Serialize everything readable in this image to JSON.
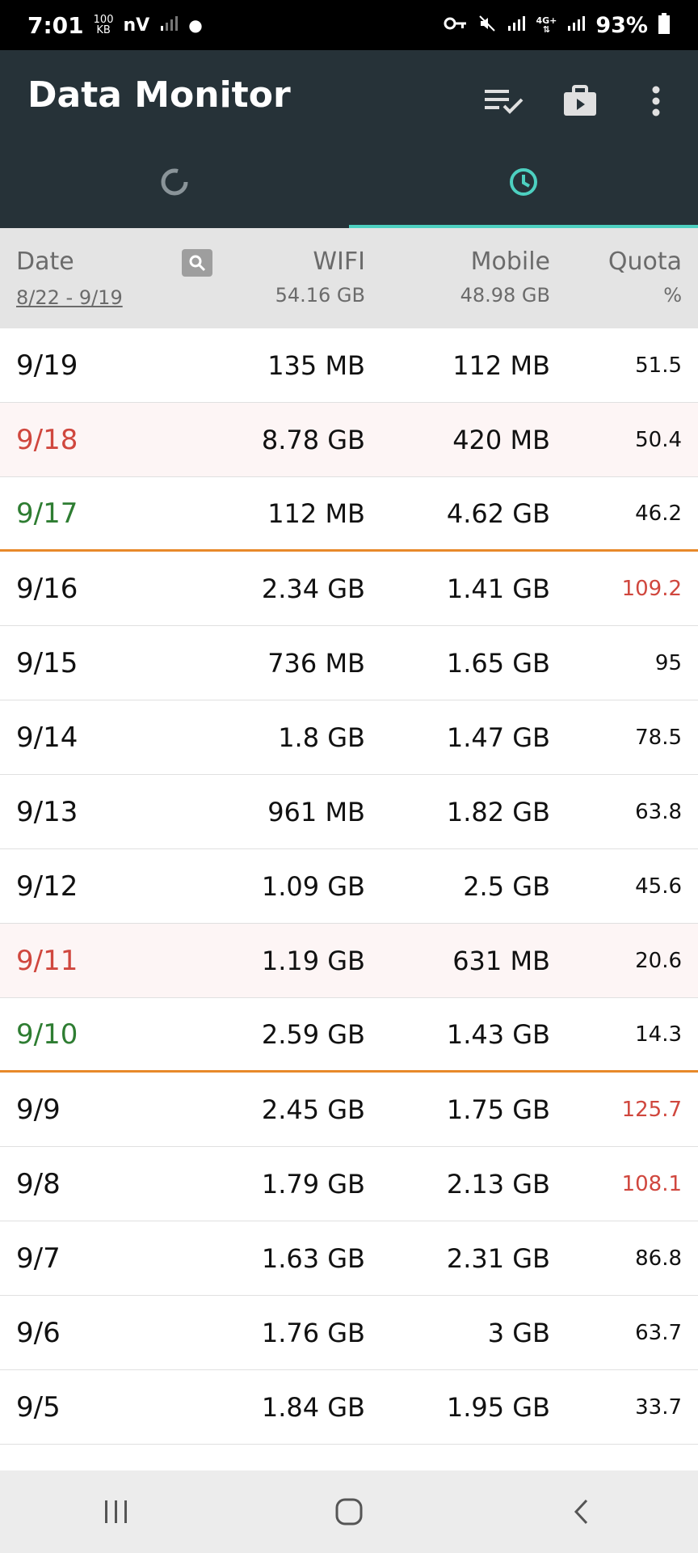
{
  "status_bar": {
    "time": "7:01",
    "speed_value": "100",
    "speed_unit": "KB",
    "carrier_text": "nV",
    "battery": "93%"
  },
  "app": {
    "title": "Data Monitor",
    "icons": [
      "checklist-icon",
      "briefcase-icon",
      "more-vert-icon"
    ],
    "tabs": [
      {
        "icon": "circle-progress-icon",
        "active": false
      },
      {
        "icon": "clock-icon",
        "active": true
      }
    ]
  },
  "header": {
    "date_label": "Date",
    "date_range": "8/22 - 9/19",
    "wifi_label": "WIFI",
    "wifi_total": "54.16 GB",
    "mobile_label": "Mobile",
    "mobile_total": "48.98 GB",
    "quota_label": "Quota",
    "quota_unit": "%"
  },
  "rows": [
    {
      "date": "9/19",
      "wifi": "135 MB",
      "mobile": "112 MB",
      "quota": "51.5"
    },
    {
      "date": "9/18",
      "wifi": "8.78 GB",
      "mobile": "420 MB",
      "quota": "50.4"
    },
    {
      "date": "9/17",
      "wifi": "112 MB",
      "mobile": "4.62 GB",
      "quota": "46.2"
    },
    {
      "date": "9/16",
      "wifi": "2.34 GB",
      "mobile": "1.41 GB",
      "quota": "109.2"
    },
    {
      "date": "9/15",
      "wifi": "736 MB",
      "mobile": "1.65 GB",
      "quota": "95"
    },
    {
      "date": "9/14",
      "wifi": "1.8 GB",
      "mobile": "1.47 GB",
      "quota": "78.5"
    },
    {
      "date": "9/13",
      "wifi": "961 MB",
      "mobile": "1.82 GB",
      "quota": "63.8"
    },
    {
      "date": "9/12",
      "wifi": "1.09 GB",
      "mobile": "2.5 GB",
      "quota": "45.6"
    },
    {
      "date": "9/11",
      "wifi": "1.19 GB",
      "mobile": "631 MB",
      "quota": "20.6"
    },
    {
      "date": "9/10",
      "wifi": "2.59 GB",
      "mobile": "1.43 GB",
      "quota": "14.3"
    },
    {
      "date": "9/9",
      "wifi": "2.45 GB",
      "mobile": "1.75 GB",
      "quota": "125.7"
    },
    {
      "date": "9/8",
      "wifi": "1.79 GB",
      "mobile": "2.13 GB",
      "quota": "108.1"
    },
    {
      "date": "9/7",
      "wifi": "1.63 GB",
      "mobile": "2.31 GB",
      "quota": "86.8"
    },
    {
      "date": "9/6",
      "wifi": "1.76 GB",
      "mobile": "3 GB",
      "quota": "63.7"
    },
    {
      "date": "9/5",
      "wifi": "1.84 GB",
      "mobile": "1.95 GB",
      "quota": "33.7"
    }
  ],
  "colors": {
    "appbar": "#263238",
    "accent": "#4dd0c0",
    "weekend_red": "#d0473e",
    "weekday_green": "#2e7d32",
    "cycle_divider": "#e8892a"
  }
}
